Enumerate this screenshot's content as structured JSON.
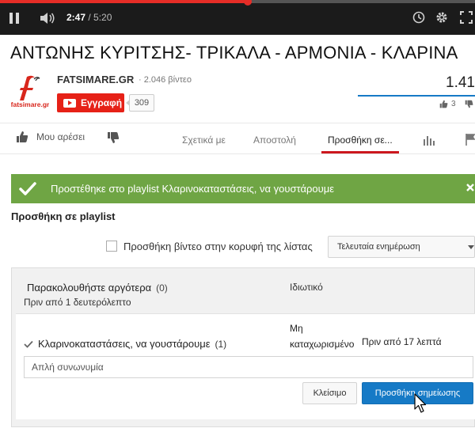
{
  "player": {
    "current_time": "2:47",
    "duration": " / 5:20",
    "progress_fraction": 0.522
  },
  "video": {
    "title": "ΑΝΤΩΝΗΣ ΚΥΡΙΤΣΗΣ- ΤΡΙΚΑΛΑ - ΑΡΜΟΝΙΑ - ΚΛΑΡΙΝΑ",
    "view_count": "1.41",
    "like_count": "3"
  },
  "channel": {
    "name": "FATSIMARE.GR",
    "video_count": "· 2.046 βίντεο",
    "subscribe_label": "Εγγραφή",
    "subscriber_count": "309",
    "logo_text": "fatsimare.gr"
  },
  "actions": {
    "like_label": "Μου αρέσει",
    "tabs": [
      "Σχετικά με",
      "Αποστολή",
      "Προσθήκη σε..."
    ]
  },
  "notification": {
    "text": "Προστέθηκε στο playlist Κλαρινοκαταστάσεις, να γουστάρουμε"
  },
  "add_to_playlist": {
    "heading": "Προσθήκη σε playlist",
    "add_to_top_label": "Προσθήκη βίντεο στην κορυφή της λίστας",
    "sort_value": "Τελευταία ενημέρωση"
  },
  "playlists": [
    {
      "name": "Παρακολουθήστε αργότερα",
      "count": "(0)",
      "privacy": "Ιδιωτικό",
      "updated": "Πριν από 1 δευτερόλεπτο"
    },
    {
      "name": "Κλαρινοκαταστάσεις, να γουστάρουμε",
      "count": "(1)",
      "privacy_line1": "Μη",
      "privacy_line2": "καταχωρισμένο",
      "updated": "Πριν από 17 λεπτά"
    }
  ],
  "note": {
    "value": "Απλή συνωνυμία",
    "close_label": "Κλείσιμο",
    "add_label": "Προσθήκη σημείωσης"
  },
  "colors": {
    "accent_red": "#e52d27",
    "subscribe_red": "#e62117",
    "success_green": "#6fa544",
    "primary_blue": "#167ac6"
  },
  "icons": [
    "pause-icon",
    "volume-icon",
    "clock-icon",
    "gear-icon",
    "fullscreen-icon",
    "like-icon",
    "dislike-icon",
    "stats-icon",
    "flag-icon",
    "check-icon",
    "close-icon"
  ]
}
